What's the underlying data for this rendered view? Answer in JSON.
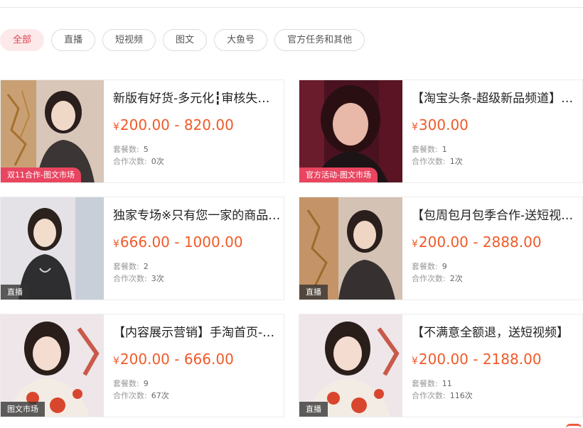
{
  "filters": [
    "全部",
    "直播",
    "短视频",
    "图文",
    "大鱼号",
    "官方任务和其他"
  ],
  "currency": "¥",
  "labels": {
    "packages": "套餐数:",
    "coops": "合作次数:"
  },
  "cards": [
    {
      "title": "新版有好货-多元化┇审核失败退款┇超级推荐",
      "price": "200.00 - 820.00",
      "packages": "5",
      "coops": "0次",
      "tag": "双11合作-图文市场",
      "tag_style": "pink"
    },
    {
      "title": "【淘宝头条-超级新品频道】内容展示",
      "price": "300.00",
      "packages": "1",
      "coops": "1次",
      "tag": "官方活动-图文市场",
      "tag_style": "pink"
    },
    {
      "title": "独家专场※只有您一家的商品直播",
      "price": "666.00 - 1000.00",
      "packages": "2",
      "coops": "3次",
      "tag": "直播",
      "tag_style": "dark"
    },
    {
      "title": "【包周包月包季合作-送短视频】",
      "price": "200.00 - 2888.00",
      "packages": "9",
      "coops": "2次",
      "tag": "直播",
      "tag_style": "dark"
    },
    {
      "title": "【内容展示营销】手淘首页-猜你喜欢",
      "price": "200.00 - 666.00",
      "packages": "9",
      "coops": "67次",
      "tag": "图文市场",
      "tag_style": "dark"
    },
    {
      "title": "【不满意全额退，送短视频】",
      "price": "200.00 - 2188.00",
      "packages": "11",
      "coops": "116次",
      "tag": "直播",
      "tag_style": "dark"
    }
  ]
}
